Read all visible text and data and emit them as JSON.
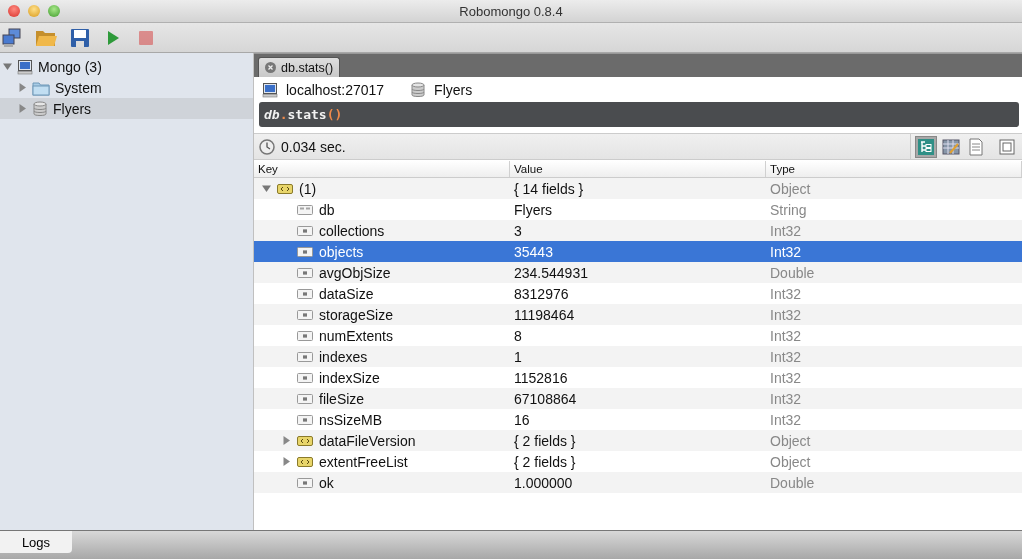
{
  "window": {
    "title": "Robomongo 0.8.4"
  },
  "toolbar": [
    {
      "kind": "connect"
    },
    {
      "kind": "open"
    },
    {
      "kind": "save"
    },
    {
      "kind": "run",
      "disabled": false
    },
    {
      "kind": "stop",
      "disabled": true
    }
  ],
  "sidebar": {
    "items": [
      {
        "label": "Mongo (3)",
        "kind": "server",
        "expanded": true,
        "selected": false,
        "children": [
          {
            "label": "System",
            "kind": "folder",
            "expanded": false,
            "selected": false
          },
          {
            "label": "Flyers",
            "kind": "database",
            "expanded": false,
            "selected": true
          }
        ]
      }
    ]
  },
  "tabs": [
    {
      "label": "db.stats()",
      "selected": true
    }
  ],
  "connection": {
    "server": "localhost:27017",
    "database": "Flyers"
  },
  "query_tokens": [
    {
      "text": "db",
      "kind": "ident"
    },
    {
      "text": ".",
      "kind": "punct"
    },
    {
      "text": "stats",
      "kind": "name"
    },
    {
      "text": "()",
      "kind": "punct"
    }
  ],
  "exec_time": "0.034 sec.",
  "view_modes": [
    {
      "kind": "tree",
      "selected": true
    },
    {
      "kind": "table",
      "selected": false
    },
    {
      "kind": "text",
      "selected": false
    },
    {
      "kind": "custom",
      "selected": false
    }
  ],
  "table": {
    "columns": [
      "Key",
      "Value",
      "Type"
    ],
    "rows": [
      {
        "key": "(1)",
        "value": "{ 14 fields }",
        "type": "Object",
        "kind": "object",
        "expanded": true,
        "selected": false,
        "children": [
          {
            "key": "db",
            "value": "Flyers",
            "type": "String",
            "kind": "string",
            "selected": false
          },
          {
            "key": "collections",
            "value": "3",
            "type": "Int32",
            "kind": "number",
            "selected": false
          },
          {
            "key": "objects",
            "value": "35443",
            "type": "Int32",
            "kind": "number",
            "selected": true
          },
          {
            "key": "avgObjSize",
            "value": "234.544931",
            "type": "Double",
            "kind": "number",
            "selected": false
          },
          {
            "key": "dataSize",
            "value": "8312976",
            "type": "Int32",
            "kind": "number",
            "selected": false
          },
          {
            "key": "storageSize",
            "value": "11198464",
            "type": "Int32",
            "kind": "number",
            "selected": false
          },
          {
            "key": "numExtents",
            "value": "8",
            "type": "Int32",
            "kind": "number",
            "selected": false
          },
          {
            "key": "indexes",
            "value": "1",
            "type": "Int32",
            "kind": "number",
            "selected": false
          },
          {
            "key": "indexSize",
            "value": "1152816",
            "type": "Int32",
            "kind": "number",
            "selected": false
          },
          {
            "key": "fileSize",
            "value": "67108864",
            "type": "Int32",
            "kind": "number",
            "selected": false
          },
          {
            "key": "nsSizeMB",
            "value": "16",
            "type": "Int32",
            "kind": "number",
            "selected": false
          },
          {
            "key": "dataFileVersion",
            "value": "{ 2 fields }",
            "type": "Object",
            "kind": "object",
            "expanded": false,
            "selected": false
          },
          {
            "key": "extentFreeList",
            "value": "{ 2 fields }",
            "type": "Object",
            "kind": "object",
            "expanded": false,
            "selected": false
          },
          {
            "key": "ok",
            "value": "1.000000",
            "type": "Double",
            "kind": "number",
            "selected": false
          }
        ]
      }
    ]
  },
  "bottom_tabs": [
    {
      "label": "Logs",
      "selected": true
    }
  ]
}
